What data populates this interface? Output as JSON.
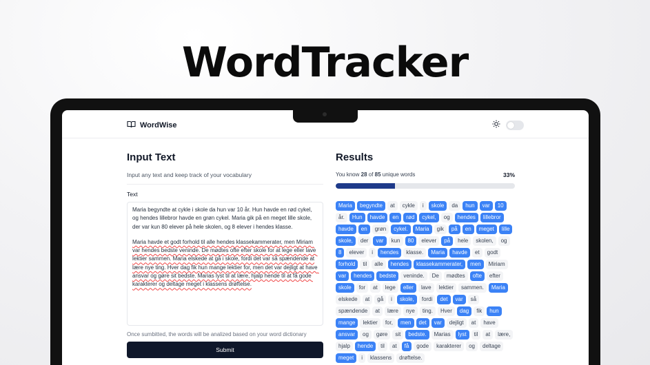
{
  "hero": {
    "title": "WordTracker"
  },
  "app": {
    "brand": "WordWise",
    "icons": {
      "logo": "book-open-icon",
      "theme": "sun-icon"
    }
  },
  "input": {
    "title": "Input Text",
    "subtitle": "Input any text and keep track of your vocabulary",
    "field_label": "Text",
    "paragraph1": "Maria begyndte at cykle i skole da hun var 10 år. Hun havde en rød cykel, og hendes lillebror havde en grøn cykel. Maria gik på en meget lille skole, der var kun 80 elever på hele skolen, og 8 elever i hendes klasse.",
    "paragraph2": "Maria havde et godt forhold til alle hendes klassekammerater, men Miriam var hendes bedste veninde. De mødtes ofte efter skole for at lege eller lave lektier sammen. Maria elskede at gå i skole, fordi det var så spændende at lære nye ting. Hver dag fik hun mange lektier for, men det var dejligt at have ansvar og gøre sit bedste. Marias lyst til at lære, hjalp hende til at få gode karakterer og deltage meget i klassens drøftelse.",
    "hint": "Once sumbitted, the words will be analized based on your word dictionary",
    "submit_label": "Submit"
  },
  "results": {
    "title": "Results",
    "known_prefix": "You know ",
    "known": "28",
    "known_mid": " of ",
    "total": "85",
    "known_suffix": " unique words",
    "percent_label": "33%",
    "progress": 0.33,
    "colors": {
      "known": "#3b82f6",
      "unknown": "#f3f4f6",
      "progress": "#1e3a8a"
    },
    "words": [
      {
        "t": "Maria",
        "k": true
      },
      {
        "t": "begyndte",
        "k": true
      },
      {
        "t": "at",
        "k": false
      },
      {
        "t": "cykle",
        "k": false
      },
      {
        "t": "i",
        "k": false
      },
      {
        "t": "skole",
        "k": true
      },
      {
        "t": "da",
        "k": false
      },
      {
        "t": "hun",
        "k": true
      },
      {
        "t": "var",
        "k": true
      },
      {
        "t": "10",
        "k": true
      },
      {
        "t": "år.",
        "k": false
      },
      {
        "t": "Hun",
        "k": true
      },
      {
        "t": "havde",
        "k": true
      },
      {
        "t": "en",
        "k": true
      },
      {
        "t": "rød",
        "k": true
      },
      {
        "t": "cykel,",
        "k": true
      },
      {
        "t": "og",
        "k": false
      },
      {
        "t": "hendes",
        "k": true
      },
      {
        "t": "lillebror",
        "k": true
      },
      {
        "t": "havde",
        "k": true
      },
      {
        "t": "en",
        "k": true
      },
      {
        "t": "grøn",
        "k": false
      },
      {
        "t": "cykel.",
        "k": true
      },
      {
        "t": "Maria",
        "k": true
      },
      {
        "t": "gik",
        "k": false
      },
      {
        "t": "på",
        "k": true
      },
      {
        "t": "en",
        "k": true
      },
      {
        "t": "meget",
        "k": true
      },
      {
        "t": "lille",
        "k": true
      },
      {
        "t": "skole,",
        "k": true
      },
      {
        "t": "der",
        "k": false
      },
      {
        "t": "var",
        "k": true
      },
      {
        "t": "kun",
        "k": false
      },
      {
        "t": "80",
        "k": true
      },
      {
        "t": "elever",
        "k": false
      },
      {
        "t": "på",
        "k": true
      },
      {
        "t": "hele",
        "k": false
      },
      {
        "t": "skolen,",
        "k": false
      },
      {
        "t": "og",
        "k": false
      },
      {
        "t": "8",
        "k": true
      },
      {
        "t": "elever",
        "k": false
      },
      {
        "t": "i",
        "k": false
      },
      {
        "t": "hendes",
        "k": true
      },
      {
        "t": "klasse.",
        "k": false
      },
      {
        "t": "Maria",
        "k": true
      },
      {
        "t": "havde",
        "k": true
      },
      {
        "t": "et",
        "k": false
      },
      {
        "t": "godt",
        "k": false
      },
      {
        "t": "forhold",
        "k": true
      },
      {
        "t": "til",
        "k": false
      },
      {
        "t": "alle",
        "k": false
      },
      {
        "t": "hendes",
        "k": true
      },
      {
        "t": "klassekammerater,",
        "k": true
      },
      {
        "t": "men",
        "k": true
      },
      {
        "t": "Miriam",
        "k": false
      },
      {
        "t": "var",
        "k": true
      },
      {
        "t": "hendes",
        "k": true
      },
      {
        "t": "bedste",
        "k": true
      },
      {
        "t": "veninde.",
        "k": false
      },
      {
        "t": "De",
        "k": false
      },
      {
        "t": "mødtes",
        "k": false
      },
      {
        "t": "ofte",
        "k": true
      },
      {
        "t": "efter",
        "k": false
      },
      {
        "t": "skole",
        "k": true
      },
      {
        "t": "for",
        "k": false
      },
      {
        "t": "at",
        "k": false
      },
      {
        "t": "lege",
        "k": false
      },
      {
        "t": "eller",
        "k": true
      },
      {
        "t": "lave",
        "k": false
      },
      {
        "t": "lektier",
        "k": false
      },
      {
        "t": "sammen.",
        "k": false
      },
      {
        "t": "Maria",
        "k": true
      },
      {
        "t": "elskede",
        "k": false
      },
      {
        "t": "at",
        "k": false
      },
      {
        "t": "gå",
        "k": false
      },
      {
        "t": "i",
        "k": false
      },
      {
        "t": "skole,",
        "k": true
      },
      {
        "t": "fordi",
        "k": false
      },
      {
        "t": "det",
        "k": true
      },
      {
        "t": "var",
        "k": true
      },
      {
        "t": "så",
        "k": false
      },
      {
        "t": "spændende",
        "k": false
      },
      {
        "t": "at",
        "k": false
      },
      {
        "t": "lære",
        "k": false
      },
      {
        "t": "nye",
        "k": false
      },
      {
        "t": "ting.",
        "k": false
      },
      {
        "t": "Hver",
        "k": false
      },
      {
        "t": "dag",
        "k": true
      },
      {
        "t": "fik",
        "k": false
      },
      {
        "t": "hun",
        "k": true
      },
      {
        "t": "mange",
        "k": true
      },
      {
        "t": "lektier",
        "k": false
      },
      {
        "t": "for,",
        "k": false
      },
      {
        "t": "men",
        "k": true
      },
      {
        "t": "det",
        "k": true
      },
      {
        "t": "var",
        "k": true
      },
      {
        "t": "dejligt",
        "k": false
      },
      {
        "t": "at",
        "k": false
      },
      {
        "t": "have",
        "k": false
      },
      {
        "t": "ansvar",
        "k": true
      },
      {
        "t": "og",
        "k": false
      },
      {
        "t": "gøre",
        "k": false
      },
      {
        "t": "sit",
        "k": false
      },
      {
        "t": "bedste.",
        "k": true
      },
      {
        "t": "Marias",
        "k": false
      },
      {
        "t": "lyst",
        "k": true
      },
      {
        "t": "til",
        "k": false
      },
      {
        "t": "at",
        "k": false
      },
      {
        "t": "lære,",
        "k": false
      },
      {
        "t": "hjalp",
        "k": false
      },
      {
        "t": "hende",
        "k": true
      },
      {
        "t": "til",
        "k": false
      },
      {
        "t": "at",
        "k": false
      },
      {
        "t": "få",
        "k": true
      },
      {
        "t": "gode",
        "k": false
      },
      {
        "t": "karakterer",
        "k": false
      },
      {
        "t": "og",
        "k": false
      },
      {
        "t": "deltage",
        "k": false
      },
      {
        "t": "meget",
        "k": true
      },
      {
        "t": "i",
        "k": false
      },
      {
        "t": "klassens",
        "k": false
      },
      {
        "t": "drøftelse.",
        "k": false
      }
    ]
  }
}
